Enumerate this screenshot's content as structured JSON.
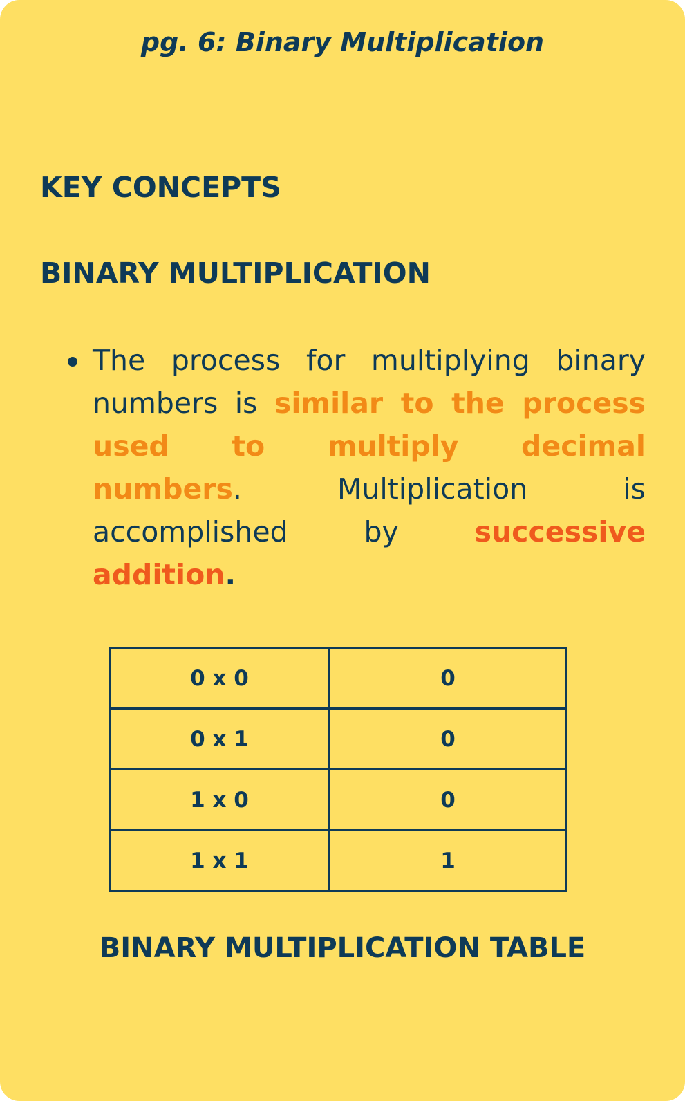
{
  "page_title": "pg. 6: Binary Multiplication",
  "headings": {
    "key_concepts": "KEY CONCEPTS",
    "section": "BINARY MULTIPLICATION"
  },
  "bullet": {
    "part1": "The process for multiplying binary numbers is ",
    "highlight1": "similar to the process used to multiply decimal numbers",
    "part2": ". Multiplication is accomplished by ",
    "highlight2": "successive addition",
    "part3": "."
  },
  "table": {
    "rows": [
      [
        "0 x 0",
        "0"
      ],
      [
        "0 x 1",
        "0"
      ],
      [
        "1 x 0",
        "0"
      ],
      [
        "1 x 1",
        "1"
      ]
    ]
  },
  "table_caption": "BINARY MULTIPLICATION TABLE",
  "colors": {
    "background": "#fedf63",
    "text": "#0e3a57",
    "highlight_orange": "#f28a17",
    "highlight_red": "#ef5a1d"
  }
}
